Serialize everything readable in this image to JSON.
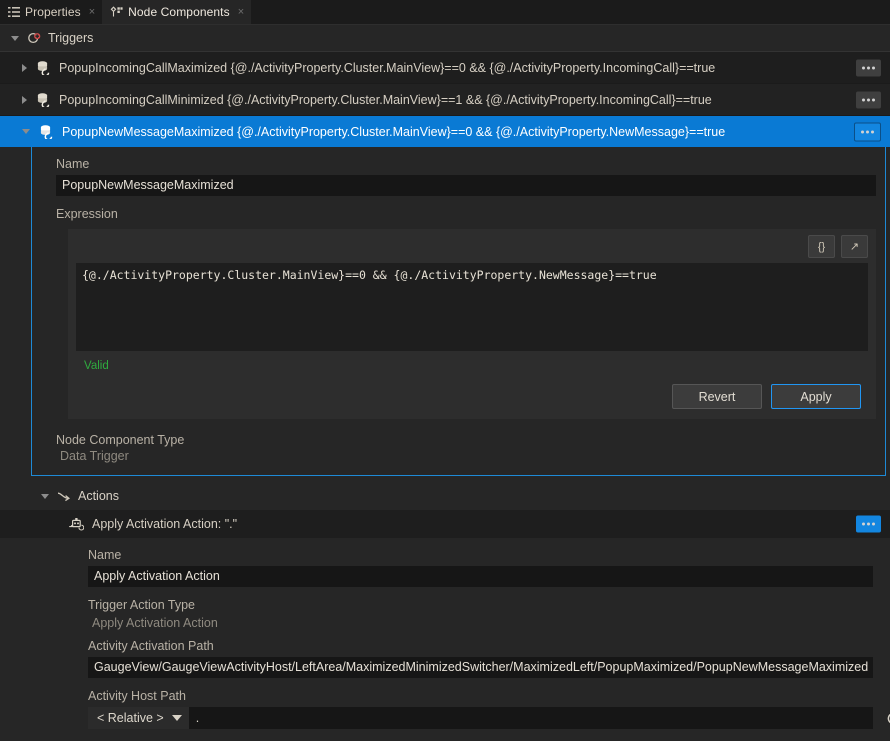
{
  "tabs": [
    {
      "label": "Properties",
      "icon": "list-icon",
      "close": "×",
      "active": false
    },
    {
      "label": "Node Components",
      "icon": "node-components-icon",
      "close": "×",
      "active": true
    }
  ],
  "triggers_section": {
    "title": "Triggers",
    "icon": "trigger-icon",
    "expanded": true
  },
  "trigger_rows": [
    {
      "name": "PopupIncomingCallMaximized {@./ActivityProperty.Cluster.MainView}==0 && {@./ActivityProperty.IncomingCall}==true",
      "expanded": false,
      "selected": false
    },
    {
      "name": "PopupIncomingCallMinimized {@./ActivityProperty.Cluster.MainView}==1 && {@./ActivityProperty.IncomingCall}==true",
      "expanded": false,
      "selected": false
    },
    {
      "name": "PopupNewMessageMaximized {@./ActivityProperty.Cluster.MainView}==0 && {@./ActivityProperty.NewMessage}==true",
      "expanded": true,
      "selected": true
    }
  ],
  "detail": {
    "name_label": "Name",
    "name_value": "PopupNewMessageMaximized",
    "expression_label": "Expression",
    "expression_value": "{@./ActivityProperty.Cluster.MainView}==0 && {@./ActivityProperty.NewMessage}==true",
    "braces_button": "{}",
    "expand_button": "↗",
    "status": "Valid",
    "status_color": "#2fab3f",
    "revert_label": "Revert",
    "apply_label": "Apply",
    "node_component_type_label": "Node Component Type",
    "node_component_type_value": "Data Trigger"
  },
  "actions_section": {
    "title": "Actions",
    "icon": "actions-arrow-icon",
    "expanded": true,
    "item": {
      "title": "Apply Activation Action: \".\"",
      "icon": "activation-action-icon",
      "name_label": "Name",
      "name_value": "Apply Activation Action",
      "trigger_action_type_label": "Trigger Action Type",
      "trigger_action_type_value": "Apply Activation Action",
      "activity_activation_path_label": "Activity Activation Path",
      "activity_activation_path_value": "GaugeView/GaugeViewActivityHost/LeftArea/MaximizedMinimizedSwitcher/MaximizedLeft/PopupMaximized/PopupNewMessageMaximized",
      "activity_host_path_label": "Activity Host Path",
      "activity_host_path_mode": "< Relative >",
      "activity_host_path_value": ".",
      "reset_icon": "reset-icon"
    }
  },
  "colors": {
    "selection_blue": "#0a7ad4",
    "focus_blue": "#2196f3",
    "panel_bg": "#262626",
    "input_bg": "#161616"
  }
}
